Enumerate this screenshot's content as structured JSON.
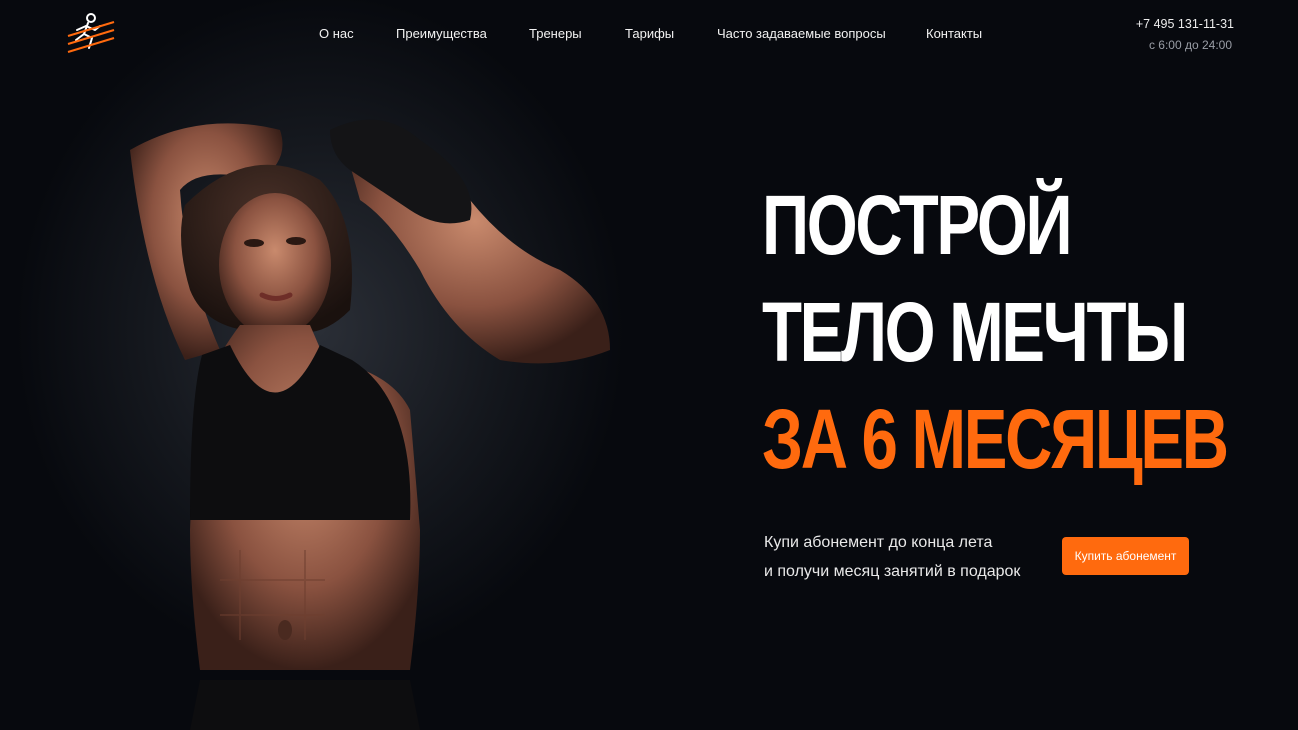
{
  "brand": {
    "logo_icon": "runner-icon",
    "accent_color": "#ff6a0e"
  },
  "nav": {
    "items": [
      {
        "label": "О нас"
      },
      {
        "label": "Преимущества"
      },
      {
        "label": "Тренеры"
      },
      {
        "label": "Тарифы"
      },
      {
        "label": "Часто задаваемые вопросы"
      },
      {
        "label": "Контакты"
      }
    ]
  },
  "contact": {
    "phone": "+7 495 131-11-31",
    "hours": "с 6:00 до 24:00"
  },
  "hero": {
    "headline": [
      "ПОСТРОЙ",
      "ТЕЛО МЕЧТЫ",
      "ЗА 6 МЕСЯЦЕВ"
    ],
    "subtitle": [
      "Купи абонемент до конца лета",
      "и получи месяц занятий в подарок"
    ],
    "cta_label": "Купить абонемент",
    "image_icon": "athlete-photo"
  }
}
